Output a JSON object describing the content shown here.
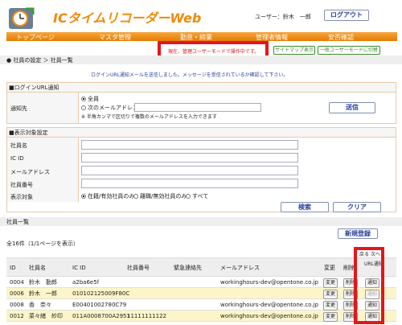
{
  "app": {
    "title": "ICタイムリコーダーWeb",
    "user_label": "ユーザー：鈴木　一郎",
    "logout": "ログアウト"
  },
  "nav": {
    "items": [
      "トップページ",
      "マスタ管理",
      "勤怠・締業",
      "管理者情報",
      "安否確認"
    ]
  },
  "notice": {
    "admin_mode": "現在、管理ユーザーモードで操作中です。"
  },
  "mode_buttons": {
    "sitemap": "サイトマップ表示",
    "general_mode": "一般ユーザーモードに切替"
  },
  "breadcrumb": "● 社員の設定 ＞ 社員一覧",
  "info_message": "ログインURL通知メールを送信しました。メッセージを受信されているか確認して下さい。",
  "login_section": {
    "heading": "■ログインURL通知",
    "label": "通知先",
    "opt_all": "全員",
    "opt_addr": "次のメールアドレス",
    "note": "※ 半角カンマで区切りで複数のメールアドレスを入力できます",
    "send_button": "送信"
  },
  "filter_section": {
    "heading": "■表示対象設定",
    "fields": [
      "社員名",
      "IC ID",
      "メールアドレス",
      "社員番号"
    ],
    "display_label": "表示対象",
    "opts": [
      "在籍/有効社員のみ",
      "離職/無効社員のみ",
      "すべて"
    ],
    "search": "検索",
    "clear": "クリア"
  },
  "list": {
    "heading": "社員一覧",
    "count": "全16件（1/1ページを表示）",
    "new_button": "新規登録",
    "prev": "戻る",
    "next": "次へ",
    "headers": [
      "ID",
      "社員名",
      "IC ID",
      "社員番号",
      "緊急連絡先",
      "メールアドレス",
      "変更",
      "削除",
      "URL通知"
    ],
    "rows": [
      {
        "id": "0004",
        "name": "鈴木　勤郎",
        "ic": "a2ba6e5f",
        "num": "",
        "emergency": "",
        "mail": "workinghours-dev@opentone.co.jp",
        "notify_enabled": true
      },
      {
        "id": "0006",
        "name": "鈴木　一郎",
        "ic": "010102125009F80C",
        "num": "",
        "emergency": "",
        "mail": "",
        "notify_enabled": false
      },
      {
        "id": "0008",
        "name": "香　奈々",
        "ic": "E00401002780C79",
        "num": "",
        "emergency": "",
        "mail": "workinghours-dev@opentone.co.jp",
        "notify_enabled": true
      },
      {
        "id": "0012",
        "name": "菜々緒　紗印",
        "ic": "011A0008700A2951",
        "num": "11111111122",
        "emergency": "",
        "mail": "workinghours-dev@opentone.co.jp",
        "notify_enabled": true
      }
    ],
    "change_label": "変更",
    "delete_label": "削除",
    "notify_label": "通知"
  },
  "colors": {
    "accent": "#f08a0b",
    "highlight_row": "#fcf5c9",
    "red_box": "#e3161b"
  }
}
